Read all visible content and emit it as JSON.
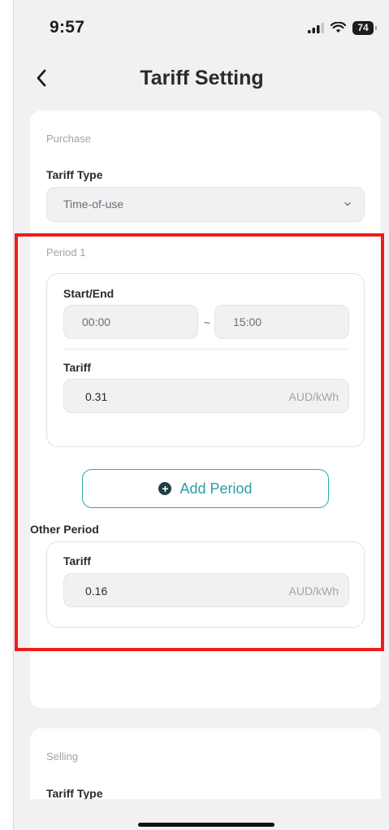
{
  "status_bar": {
    "time": "9:57",
    "battery": "74"
  },
  "nav": {
    "title": "Tariff Setting"
  },
  "purchase": {
    "section_label": "Purchase",
    "tariff_type_label": "Tariff Type",
    "tariff_type_value": "Time-of-use",
    "period_1": {
      "label": "Period 1",
      "start_end_label": "Start/End",
      "start": "00:00",
      "separator": "~",
      "end": "15:00",
      "tariff_label": "Tariff",
      "tariff_value": "0.31",
      "unit": "AUD/kWh"
    },
    "add_period_label": "Add Period",
    "other_period": {
      "label": "Other Period",
      "tariff_label": "Tariff",
      "tariff_value": "0.16",
      "unit": "AUD/kWh"
    }
  },
  "selling": {
    "section_label": "Selling",
    "tariff_type_label": "Tariff Type"
  },
  "colors": {
    "accent": "#28aab0",
    "highlight": "#ee1c1c",
    "background": "#f1f1f3"
  }
}
